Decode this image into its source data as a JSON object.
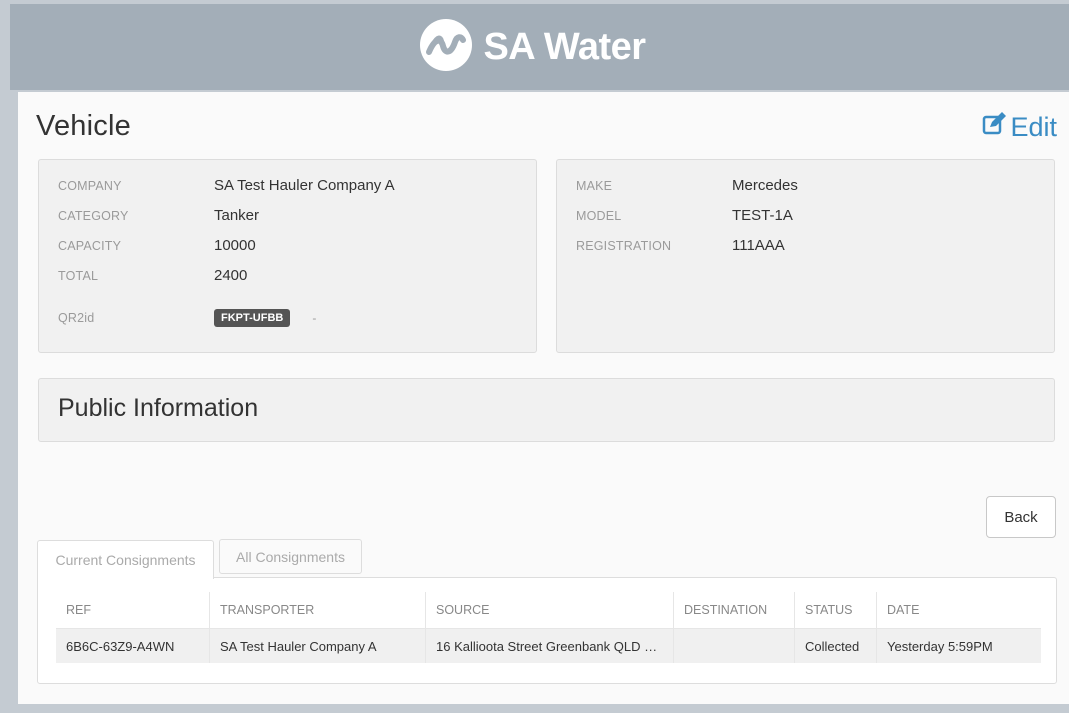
{
  "brand": {
    "name": "SA Water",
    "logo_icon": "sa-water-wave-logo"
  },
  "page": {
    "title": "Vehicle",
    "edit_label": "Edit"
  },
  "vehicle": {
    "left": [
      {
        "label": "COMPANY",
        "value": "SA Test Hauler Company A"
      },
      {
        "label": "CATEGORY",
        "value": "Tanker"
      },
      {
        "label": "CAPACITY",
        "value": "10000"
      },
      {
        "label": "TOTAL",
        "value": "2400"
      }
    ],
    "qr": {
      "label": "QR2id",
      "badge": "FKPT-UFBB",
      "extra": "-"
    },
    "right": [
      {
        "label": "MAKE",
        "value": "Mercedes"
      },
      {
        "label": "MODEL",
        "value": "TEST-1A"
      },
      {
        "label": "REGISTRATION",
        "value": "111AAA"
      }
    ]
  },
  "public_info": {
    "title": "Public Information"
  },
  "back_label": "Back",
  "tabs": [
    {
      "label": "Current Consignments",
      "active": true
    },
    {
      "label": "All Consignments",
      "active": false
    }
  ],
  "table": {
    "headers": [
      "REF",
      "TRANSPORTER",
      "SOURCE",
      "DESTINATION",
      "STATUS",
      "DATE"
    ],
    "rows": [
      [
        "6B6C-63Z9-A4WN",
        "SA Test Hauler Company A",
        "16 Kallioota Street Greenbank QLD …",
        "",
        "Collected",
        "Yesterday 5:59PM"
      ]
    ]
  },
  "colors": {
    "header_bg": "#a3aeb8",
    "accent": "#3a8cc4",
    "badge_bg": "#555555"
  }
}
